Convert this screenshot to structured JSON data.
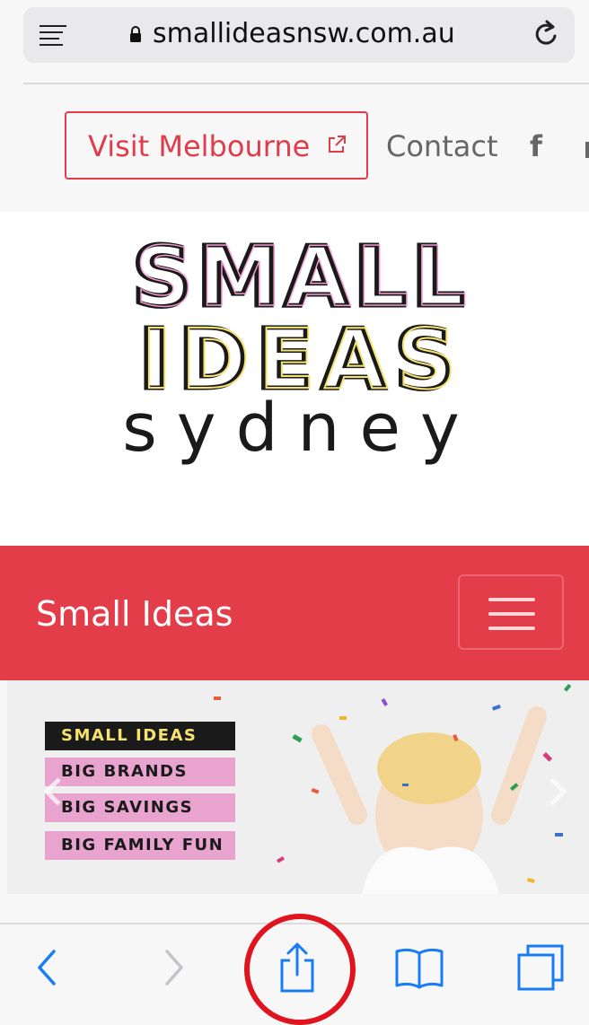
{
  "address_bar": {
    "url": "smallideasnsw.com.au"
  },
  "top_nav": {
    "visit_label": "Visit Melbourne",
    "contact_label": "Contact",
    "facebook_glyph": "f"
  },
  "logo": {
    "line1": "SMALL",
    "line2": "IDEAS",
    "line3": "sydney"
  },
  "site_header": {
    "brand": "Small Ideas"
  },
  "hero": {
    "tags": [
      "SMALL IDEAS",
      "BIG BRANDS",
      "BIG SAVINGS",
      "BIG FAMILY FUN"
    ]
  },
  "colors": {
    "brand_red": "#e43d4a",
    "ios_blue": "#1a7cf5",
    "highlight_red": "#e0141e",
    "tag_pink": "#e9a3cf",
    "tag_yellow": "#f5e26f"
  },
  "icons": {
    "reader": "reader-icon",
    "lock": "lock-icon",
    "reload": "reload-icon",
    "external": "external-link-icon",
    "back": "back-icon",
    "forward": "forward-icon",
    "share": "share-icon",
    "bookmarks": "bookmarks-icon",
    "tabs": "tabs-icon"
  }
}
